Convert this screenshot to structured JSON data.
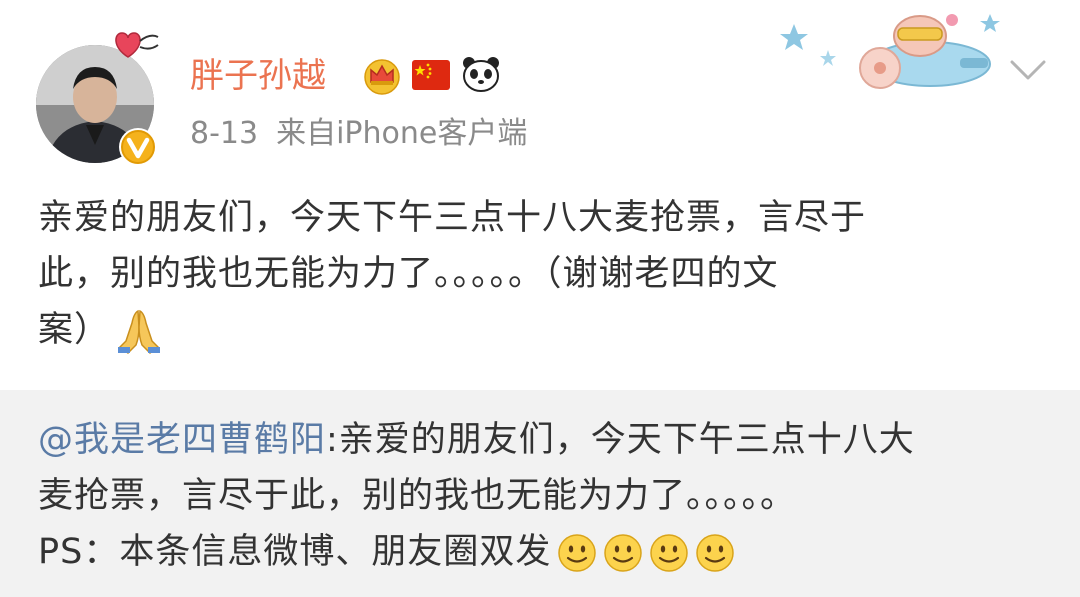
{
  "post": {
    "username": "胖子孙越",
    "date": "8-13",
    "source": "来自iPhone客户端",
    "text_line1": "亲爱的朋友们，今天下午三点十八大麦抢票，言尽于",
    "text_line2": "此，别的我也无能为力了。。。。。（谢谢老四的文",
    "text_line3": "案）"
  },
  "repost": {
    "mention": "@我是老四曹鹤阳",
    "colon_text": ":亲爱的朋友们，今天下午三点十八大",
    "line2": "麦抢票，言尽于此，别的我也无能为力了。。。。。",
    "line3": "PS：本条信息微博、朋友圈双发"
  },
  "colors": {
    "username": "#eb7350",
    "mention": "#5a7ba6",
    "meta": "#8a8a8a",
    "repost_bg": "#f2f2f2"
  },
  "icons": [
    "heart-icon",
    "verified-v-icon",
    "crown-icon",
    "china-flag-icon",
    "panda-icon",
    "chevron-down-icon",
    "praying-hands-icon",
    "smile-emoji-icon"
  ]
}
